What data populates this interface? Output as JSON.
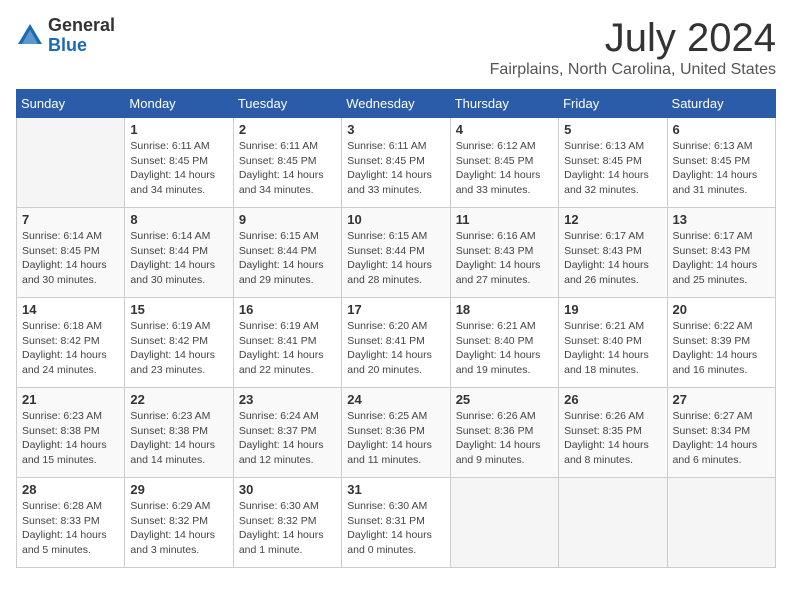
{
  "header": {
    "logo_general": "General",
    "logo_blue": "Blue",
    "month_title": "July 2024",
    "location": "Fairplains, North Carolina, United States"
  },
  "days_of_week": [
    "Sunday",
    "Monday",
    "Tuesday",
    "Wednesday",
    "Thursday",
    "Friday",
    "Saturday"
  ],
  "weeks": [
    [
      {
        "day": "",
        "info": ""
      },
      {
        "day": "1",
        "info": "Sunrise: 6:11 AM\nSunset: 8:45 PM\nDaylight: 14 hours\nand 34 minutes."
      },
      {
        "day": "2",
        "info": "Sunrise: 6:11 AM\nSunset: 8:45 PM\nDaylight: 14 hours\nand 34 minutes."
      },
      {
        "day": "3",
        "info": "Sunrise: 6:11 AM\nSunset: 8:45 PM\nDaylight: 14 hours\nand 33 minutes."
      },
      {
        "day": "4",
        "info": "Sunrise: 6:12 AM\nSunset: 8:45 PM\nDaylight: 14 hours\nand 33 minutes."
      },
      {
        "day": "5",
        "info": "Sunrise: 6:13 AM\nSunset: 8:45 PM\nDaylight: 14 hours\nand 32 minutes."
      },
      {
        "day": "6",
        "info": "Sunrise: 6:13 AM\nSunset: 8:45 PM\nDaylight: 14 hours\nand 31 minutes."
      }
    ],
    [
      {
        "day": "7",
        "info": "Sunrise: 6:14 AM\nSunset: 8:45 PM\nDaylight: 14 hours\nand 30 minutes."
      },
      {
        "day": "8",
        "info": "Sunrise: 6:14 AM\nSunset: 8:44 PM\nDaylight: 14 hours\nand 30 minutes."
      },
      {
        "day": "9",
        "info": "Sunrise: 6:15 AM\nSunset: 8:44 PM\nDaylight: 14 hours\nand 29 minutes."
      },
      {
        "day": "10",
        "info": "Sunrise: 6:15 AM\nSunset: 8:44 PM\nDaylight: 14 hours\nand 28 minutes."
      },
      {
        "day": "11",
        "info": "Sunrise: 6:16 AM\nSunset: 8:43 PM\nDaylight: 14 hours\nand 27 minutes."
      },
      {
        "day": "12",
        "info": "Sunrise: 6:17 AM\nSunset: 8:43 PM\nDaylight: 14 hours\nand 26 minutes."
      },
      {
        "day": "13",
        "info": "Sunrise: 6:17 AM\nSunset: 8:43 PM\nDaylight: 14 hours\nand 25 minutes."
      }
    ],
    [
      {
        "day": "14",
        "info": "Sunrise: 6:18 AM\nSunset: 8:42 PM\nDaylight: 14 hours\nand 24 minutes."
      },
      {
        "day": "15",
        "info": "Sunrise: 6:19 AM\nSunset: 8:42 PM\nDaylight: 14 hours\nand 23 minutes."
      },
      {
        "day": "16",
        "info": "Sunrise: 6:19 AM\nSunset: 8:41 PM\nDaylight: 14 hours\nand 22 minutes."
      },
      {
        "day": "17",
        "info": "Sunrise: 6:20 AM\nSunset: 8:41 PM\nDaylight: 14 hours\nand 20 minutes."
      },
      {
        "day": "18",
        "info": "Sunrise: 6:21 AM\nSunset: 8:40 PM\nDaylight: 14 hours\nand 19 minutes."
      },
      {
        "day": "19",
        "info": "Sunrise: 6:21 AM\nSunset: 8:40 PM\nDaylight: 14 hours\nand 18 minutes."
      },
      {
        "day": "20",
        "info": "Sunrise: 6:22 AM\nSunset: 8:39 PM\nDaylight: 14 hours\nand 16 minutes."
      }
    ],
    [
      {
        "day": "21",
        "info": "Sunrise: 6:23 AM\nSunset: 8:38 PM\nDaylight: 14 hours\nand 15 minutes."
      },
      {
        "day": "22",
        "info": "Sunrise: 6:23 AM\nSunset: 8:38 PM\nDaylight: 14 hours\nand 14 minutes."
      },
      {
        "day": "23",
        "info": "Sunrise: 6:24 AM\nSunset: 8:37 PM\nDaylight: 14 hours\nand 12 minutes."
      },
      {
        "day": "24",
        "info": "Sunrise: 6:25 AM\nSunset: 8:36 PM\nDaylight: 14 hours\nand 11 minutes."
      },
      {
        "day": "25",
        "info": "Sunrise: 6:26 AM\nSunset: 8:36 PM\nDaylight: 14 hours\nand 9 minutes."
      },
      {
        "day": "26",
        "info": "Sunrise: 6:26 AM\nSunset: 8:35 PM\nDaylight: 14 hours\nand 8 minutes."
      },
      {
        "day": "27",
        "info": "Sunrise: 6:27 AM\nSunset: 8:34 PM\nDaylight: 14 hours\nand 6 minutes."
      }
    ],
    [
      {
        "day": "28",
        "info": "Sunrise: 6:28 AM\nSunset: 8:33 PM\nDaylight: 14 hours\nand 5 minutes."
      },
      {
        "day": "29",
        "info": "Sunrise: 6:29 AM\nSunset: 8:32 PM\nDaylight: 14 hours\nand 3 minutes."
      },
      {
        "day": "30",
        "info": "Sunrise: 6:30 AM\nSunset: 8:32 PM\nDaylight: 14 hours\nand 1 minute."
      },
      {
        "day": "31",
        "info": "Sunrise: 6:30 AM\nSunset: 8:31 PM\nDaylight: 14 hours\nand 0 minutes."
      },
      {
        "day": "",
        "info": ""
      },
      {
        "day": "",
        "info": ""
      },
      {
        "day": "",
        "info": ""
      }
    ]
  ]
}
